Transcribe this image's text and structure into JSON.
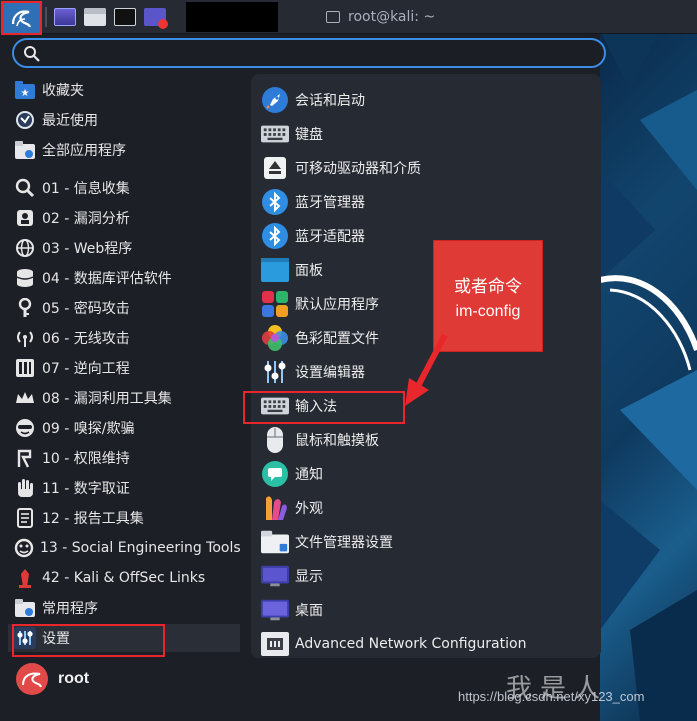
{
  "taskbar": {
    "window_title": "root@kali: ~"
  },
  "search": {
    "placeholder": ""
  },
  "categories": [
    {
      "label": "收藏夹",
      "icon": "star-folder-icon"
    },
    {
      "label": "最近使用",
      "icon": "recent-icon"
    },
    {
      "label": "全部应用程序",
      "icon": "all-apps-folder-icon"
    },
    {
      "label": "01 - 信息收集",
      "icon": "magnifier-icon"
    },
    {
      "label": "02 - 漏洞分析",
      "icon": "vuln-analysis-icon"
    },
    {
      "label": "03 - Web程序",
      "icon": "web-globe-icon"
    },
    {
      "label": "04 - 数据库评估软件",
      "icon": "database-icon"
    },
    {
      "label": "05 - 密码攻击",
      "icon": "key-icon"
    },
    {
      "label": "06 - 无线攻击",
      "icon": "wireless-icon"
    },
    {
      "label": "07 - 逆向工程",
      "icon": "reverse-engineering-icon"
    },
    {
      "label": "08 - 漏洞利用工具集",
      "icon": "exploit-crown-icon"
    },
    {
      "label": "09 - 嗅探/欺骗",
      "icon": "sniffing-mask-icon"
    },
    {
      "label": "10 - 权限维持",
      "icon": "persistence-icon"
    },
    {
      "label": "11 - 数字取证",
      "icon": "forensics-hand-icon"
    },
    {
      "label": "12 - 报告工具集",
      "icon": "report-icon"
    },
    {
      "label": "13 - Social Engineering Tools",
      "icon": "social-engineering-icon"
    },
    {
      "label": "42 - Kali & OffSec Links",
      "icon": "kali-links-icon"
    },
    {
      "label": "常用程序",
      "icon": "common-apps-folder-icon"
    },
    {
      "label": "设置",
      "icon": "settings-icon"
    }
  ],
  "apps": [
    {
      "label": "会话和启动",
      "icon": "rocket-icon"
    },
    {
      "label": "键盘",
      "icon": "keyboard-icon"
    },
    {
      "label": "可移动驱动器和介质",
      "icon": "eject-icon"
    },
    {
      "label": "蓝牙管理器",
      "icon": "bluetooth-icon"
    },
    {
      "label": "蓝牙适配器",
      "icon": "bluetooth-icon"
    },
    {
      "label": "面板",
      "icon": "panel-icon"
    },
    {
      "label": "默认应用程序",
      "icon": "default-apps-icon"
    },
    {
      "label": "色彩配置文件",
      "icon": "color-profile-icon"
    },
    {
      "label": "设置编辑器",
      "icon": "settings-editor-icon"
    },
    {
      "label": "输入法",
      "icon": "keyboard-icon"
    },
    {
      "label": "鼠标和触摸板",
      "icon": "mouse-icon"
    },
    {
      "label": "通知",
      "icon": "notification-icon"
    },
    {
      "label": "外观",
      "icon": "appearance-icon"
    },
    {
      "label": "文件管理器设置",
      "icon": "file-manager-icon"
    },
    {
      "label": "显示",
      "icon": "display-icon"
    },
    {
      "label": "桌面",
      "icon": "desktop-icon"
    },
    {
      "label": "Advanced Network Configuration",
      "icon": "network-icon"
    }
  ],
  "user": {
    "name": "root"
  },
  "annotation": {
    "line1": "或者命令",
    "line2": "im-config"
  },
  "watermark": {
    "url": "https://blog.csdn.net/xy123_com",
    "glyphs": "我是人"
  },
  "colors": {
    "accent": "#3a8ee6",
    "highlight": "#e8262b",
    "callout_bg": "#e03a36"
  }
}
